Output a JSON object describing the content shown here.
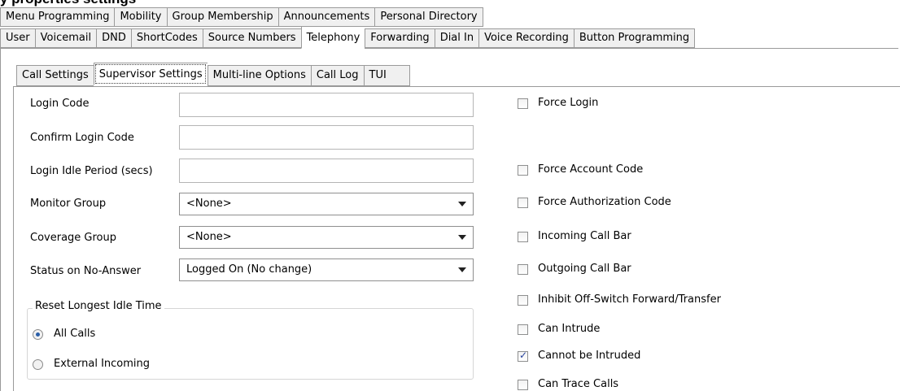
{
  "title": "y properties settings",
  "tabs_row1": [
    "Menu Programming",
    "Mobility",
    "Group Membership",
    "Announcements",
    "Personal Directory"
  ],
  "tabs_row2": [
    "User",
    "Voicemail",
    "DND",
    "ShortCodes",
    "Source Numbers",
    "Telephony",
    "Forwarding",
    "Dial In",
    "Voice Recording",
    "Button Programming"
  ],
  "active_tab": "Telephony",
  "subtabs": [
    "Call Settings",
    "Supervisor Settings",
    "Multi-line Options",
    "Call Log",
    "TUI"
  ],
  "active_subtab": "Supervisor Settings",
  "form": {
    "login_code": {
      "label": "Login Code",
      "value": ""
    },
    "confirm_login_code": {
      "label": "Confirm Login Code",
      "value": ""
    },
    "login_idle_period": {
      "label": "Login Idle Period (secs)",
      "value": ""
    },
    "monitor_group": {
      "label": "Monitor Group",
      "value": "<None>"
    },
    "coverage_group": {
      "label": "Coverage Group",
      "value": "<None>"
    },
    "status_no_answer": {
      "label": "Status on No-Answer",
      "value": "Logged On (No change)"
    }
  },
  "reset_group": {
    "legend": "Reset Longest Idle Time",
    "options": [
      {
        "label": "All Calls",
        "selected": true
      },
      {
        "label": "External Incoming",
        "selected": false
      }
    ]
  },
  "checkboxes": [
    {
      "label": "Force Login",
      "checked": false
    },
    {
      "label": "Force Account Code",
      "checked": false
    },
    {
      "label": "Force Authorization Code",
      "checked": false
    },
    {
      "label": "Incoming Call Bar",
      "checked": false
    },
    {
      "label": "Outgoing Call Bar",
      "checked": false
    },
    {
      "label": "Inhibit Off-Switch Forward/Transfer",
      "checked": false
    },
    {
      "label": "Can Intrude",
      "checked": false
    },
    {
      "label": "Cannot be Intruded",
      "checked": true
    },
    {
      "label": "Can Trace Calls",
      "checked": false
    }
  ]
}
